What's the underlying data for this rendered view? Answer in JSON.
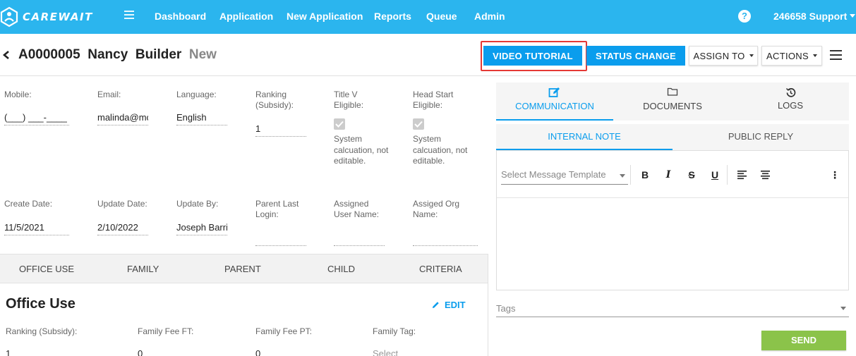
{
  "navbar": {
    "brand": "CAREWAIT",
    "items": [
      "Dashboard",
      "Application",
      "New Application",
      "Reports",
      "Queue",
      "Admin"
    ],
    "help": "?",
    "user": "246658 Support"
  },
  "header": {
    "record_id": "A0000005",
    "first_name": "Nancy",
    "last_name": "Builder",
    "status": "New",
    "buttons": {
      "video_tutorial": "VIDEO TUTORIAL",
      "status_change": "STATUS CHANGE",
      "assign_to": "ASSIGN TO",
      "actions": "ACTIONS"
    }
  },
  "fields_row1": {
    "mobile_label": "Mobile:",
    "mobile_value": "(___) ___-____",
    "email_label": "Email:",
    "email_value": "malinda@mc",
    "language_label": "Language:",
    "language_value": "English",
    "ranking_label": "Ranking (Subsidy):",
    "ranking_value": "1",
    "titlev_label": "Title V Eligible:",
    "titlev_note": "System calcuation, not editable.",
    "headstart_label": "Head Start Eligible:",
    "headstart_note": "System calcuation, not editable."
  },
  "fields_row2": {
    "create_label": "Create Date:",
    "create_value": "11/5/2021",
    "update_label": "Update Date:",
    "update_value": "2/10/2022",
    "updateby_label": "Update By:",
    "updateby_value": "Joseph Barri",
    "parentlogin_label": "Parent Last Login:",
    "assigneduser_label": "Assigned User Name:",
    "assignedorg_label": "Assiged Org Name:"
  },
  "left_tabs": [
    "OFFICE USE",
    "FAMILY",
    "PARENT",
    "CHILD",
    "CRITERIA"
  ],
  "office_use": {
    "title": "Office Use",
    "edit": "EDIT",
    "labels": [
      "Ranking (Subsidy):",
      "Family Fee FT:",
      "Family Fee PT:",
      "Family Tag:"
    ],
    "values": [
      "1",
      "0",
      "0",
      "Select"
    ]
  },
  "right_panel": {
    "tabs": [
      "COMMUNICATION",
      "DOCUMENTS",
      "LOGS"
    ],
    "subtabs": [
      "INTERNAL NOTE",
      "PUBLIC REPLY"
    ],
    "template_placeholder": "Select Message Template",
    "toolbar": {
      "bold": "B",
      "italic": "I",
      "strike": "S",
      "underline": "U",
      "more": "⋮"
    },
    "tags_placeholder": "Tags",
    "send": "SEND"
  }
}
